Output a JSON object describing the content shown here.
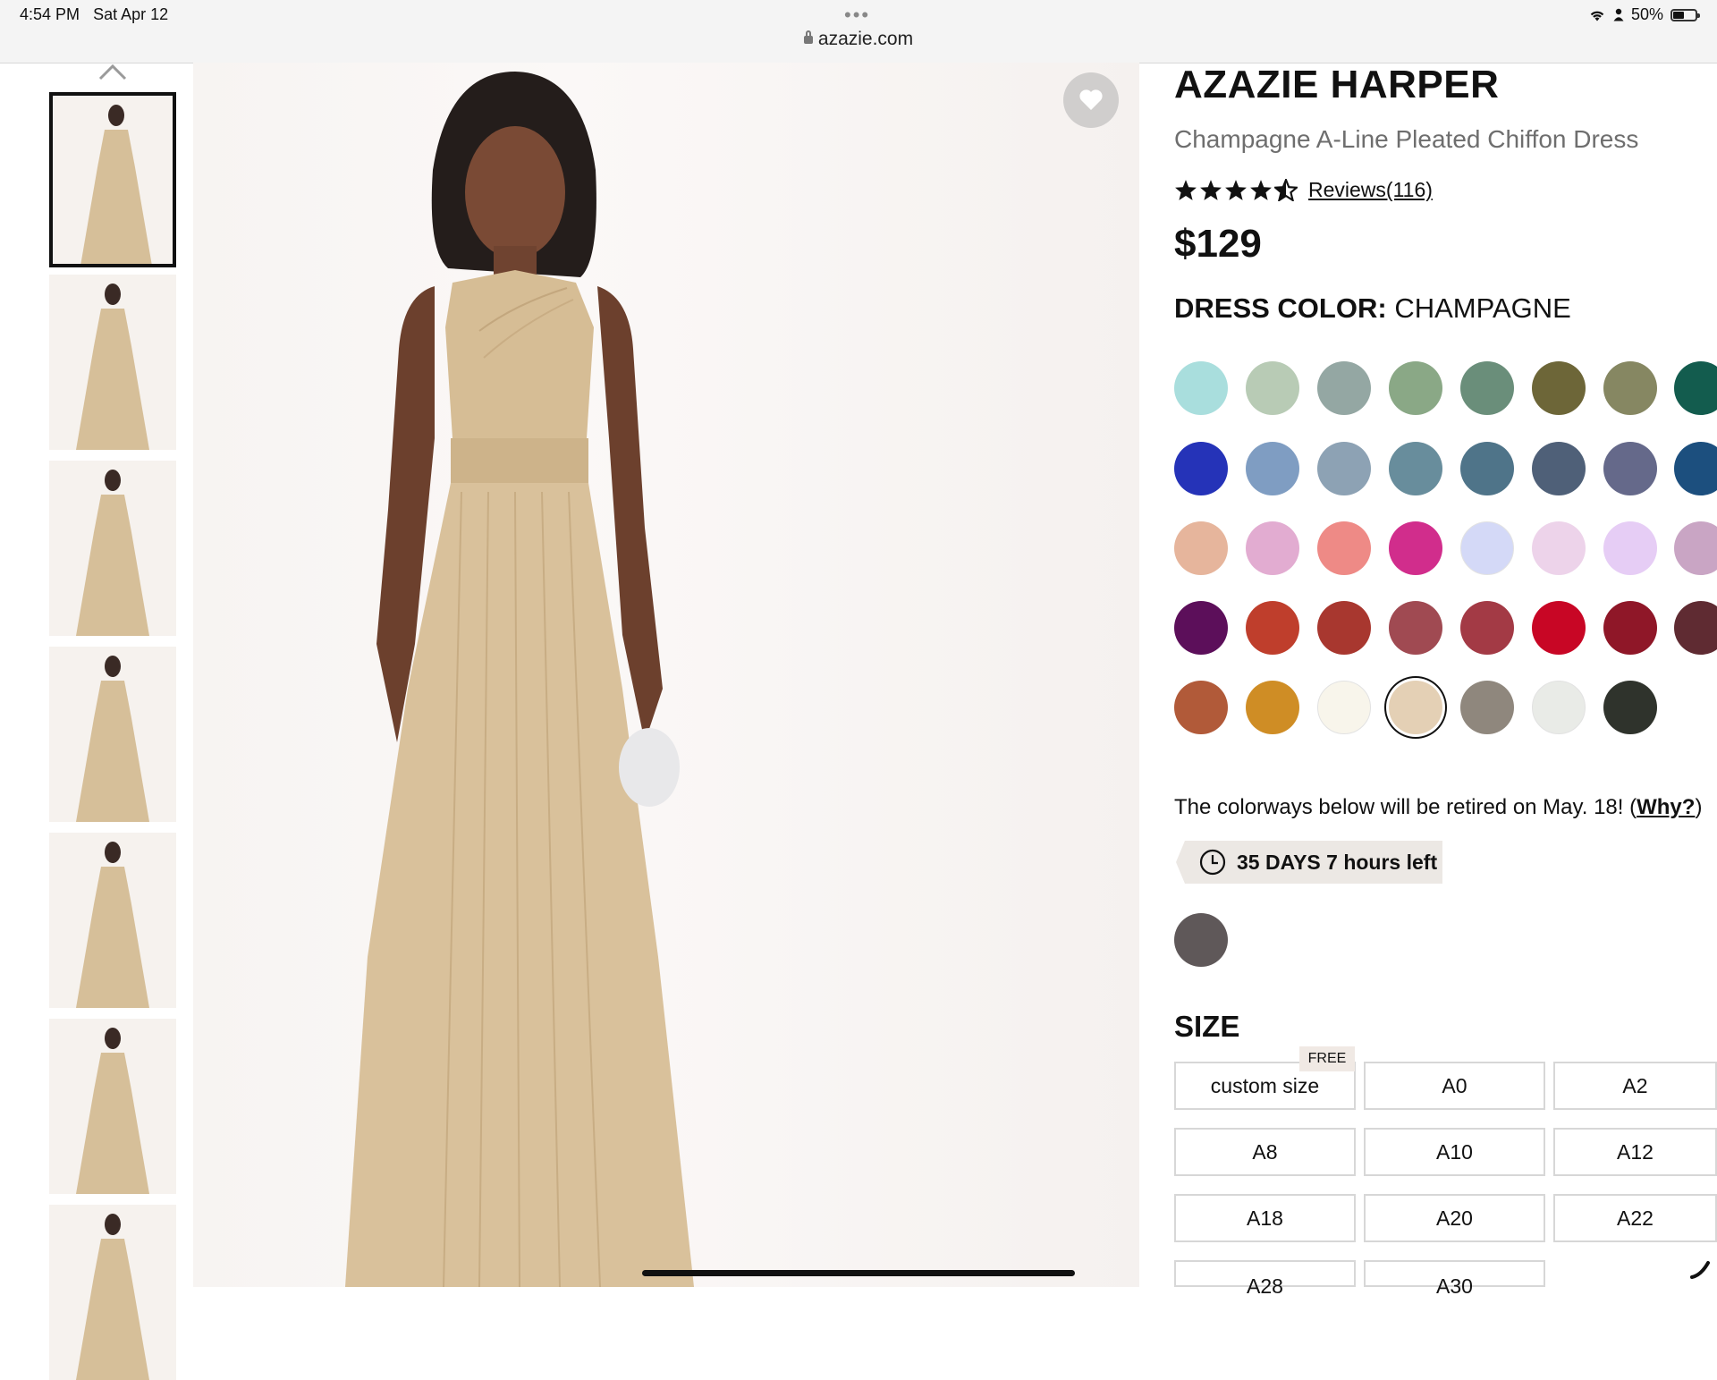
{
  "status_bar": {
    "time": "4:54 PM",
    "date": "Sat Apr 12",
    "url": "azazie.com",
    "battery": "50%"
  },
  "gallery": {
    "thumbnail_count": 7,
    "active_index": 0
  },
  "product": {
    "brand": "AZAZIE HARPER",
    "name": "Champagne A-Line Pleated Chiffon Dress",
    "rating": 4.5,
    "reviews_label": "Reviews(116)",
    "price": "$129",
    "color_label": "DRESS COLOR:",
    "color_value": "CHAMPAGNE"
  },
  "colors": {
    "rows": [
      [
        "#a9dedd",
        "#b8cbb5",
        "#94a7a3",
        "#8aa886",
        "#6a8e7a",
        "#6d6638",
        "#868762",
        "#135c4e"
      ],
      [
        "#2533b8",
        "#7f9dc2",
        "#8da2b4",
        "#688d9c",
        "#4f7489",
        "#4f6078",
        "#65698a",
        "#1c4f7e"
      ],
      [
        "#e6b59c",
        "#e2acd1",
        "#ee8a86",
        "#d12d8c",
        "#d4d9f7",
        "#edd3ea",
        "#e6cdf5",
        "#c9a5c4"
      ],
      [
        "#5c0f5a",
        "#bf3e2c",
        "#a8372f",
        "#a04a52",
        "#a33a45",
        "#c80625",
        "#8f1728",
        "#5f2b32"
      ],
      [
        "#b15a39",
        "#cf8d25",
        "#f8f5eb",
        "#e4d0b5",
        "#8f877d",
        "#e9ebe7",
        "#2f332c"
      ]
    ],
    "selected": {
      "row": 4,
      "index": 3
    },
    "retire_text": "The colorways below will be retired on May. 18! (",
    "why_link": "Why?",
    "retire_close": ")",
    "countdown": "35 DAYS 7 hours left",
    "retiring_colors": [
      "#5f5859"
    ]
  },
  "sizes": {
    "label": "SIZE",
    "free_badge": "FREE",
    "options": [
      [
        "custom size",
        "A0",
        "A2"
      ],
      [
        "A8",
        "A10",
        "A12"
      ],
      [
        "A18",
        "A20",
        "A22"
      ],
      [
        "A28",
        "A30"
      ]
    ]
  }
}
